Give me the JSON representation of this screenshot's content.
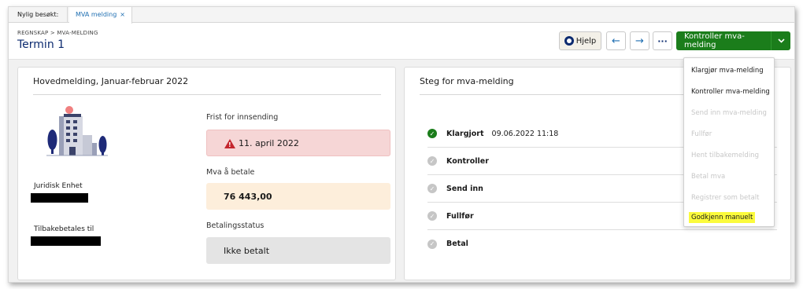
{
  "tabs": {
    "recent_label": "Nylig besøkt:",
    "active_label": "MVA melding",
    "close_glyph": "×"
  },
  "header": {
    "breadcrumb": "REGNSKAP > MVA-MELDING",
    "title": "Termin 1",
    "help_label": "Hjelp",
    "back_glyph": "←",
    "forward_glyph": "→",
    "more_glyph": "···",
    "primary_label": "Kontroller mva-melding",
    "primary_caret": "⌄"
  },
  "left_panel": {
    "title": "Hovedmelding, Januar-februar 2022",
    "legal_entity_label": "Juridisk Enhet",
    "refund_label": "Tilbakebetales til",
    "deadline_label": "Frist for innsending",
    "deadline_value": "11. april 2022",
    "amount_label": "Mva å betale",
    "amount_value": "76 443,00",
    "payment_status_label": "Betalingsstatus",
    "payment_status_value": "Ikke betalt"
  },
  "right_panel": {
    "title": "Steg for mva-melding",
    "steps": [
      {
        "name": "Klargjort",
        "date": "09.06.2022 11:18",
        "status": "done"
      },
      {
        "name": "Kontroller",
        "date": "",
        "status": "pending"
      },
      {
        "name": "Send inn",
        "date": "",
        "status": "pending"
      },
      {
        "name": "Fullfør",
        "date": "",
        "status": "pending"
      },
      {
        "name": "Betal",
        "date": "",
        "status": "pending"
      }
    ]
  },
  "dropdown": {
    "items": [
      {
        "label": "Klargjør mva-melding",
        "enabled": true
      },
      {
        "label": "Kontroller mva-melding",
        "enabled": true
      },
      {
        "label": "Send inn mva-melding",
        "enabled": false
      },
      {
        "label": "Fullfør",
        "enabled": false
      },
      {
        "label": "Hent tilbakemelding",
        "enabled": false
      },
      {
        "label": "Betal mva",
        "enabled": false
      },
      {
        "label": "Registrer som betalt",
        "enabled": false
      },
      {
        "label": "Godkjenn manuelt",
        "enabled": true,
        "highlighted": true
      }
    ]
  },
  "icons": {
    "help": "lifebuoy-icon",
    "warning": "warning-triangle-icon",
    "check": "check-circle-icon"
  },
  "colors": {
    "primary": "#1b7d1b",
    "title": "#0b2a6f",
    "link": "#1f6fb2",
    "deadline_bg": "#f6d6d6",
    "amount_bg": "#fdeedb",
    "status_bg": "#e4e4e4",
    "warning": "#c4262e",
    "highlight": "#fbfb3c"
  }
}
